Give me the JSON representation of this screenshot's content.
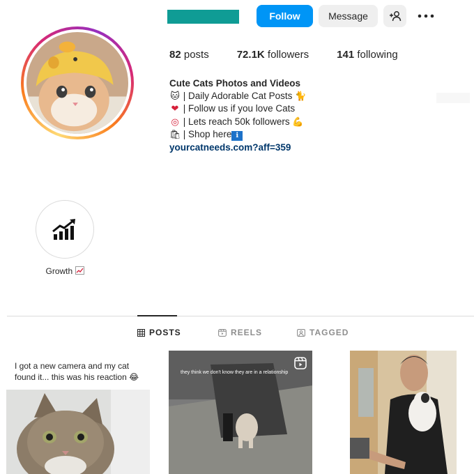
{
  "profile": {
    "follow_label": "Follow",
    "message_label": "Message",
    "stats": {
      "posts_count": "82",
      "posts_label": "posts",
      "followers_count": "72.1K",
      "followers_label": "followers",
      "following_count": "141",
      "following_label": "following"
    },
    "bio": {
      "name": "Cute Cats Photos and Videos",
      "line1": "| Daily Adorable Cat Posts",
      "line2": "| Follow us if you love Cats",
      "line3": "| Lets reach 50k followers",
      "line4": "| Shop here",
      "link": "yourcatneeds.com?aff=359"
    },
    "username_redaction_color": "#0f9c95",
    "accent_color": "#0095f6"
  },
  "highlights": [
    {
      "label": "Growth",
      "icon": "chart-increasing-icon"
    }
  ],
  "tabs": [
    {
      "label": "POSTS",
      "icon": "grid-icon",
      "active": true
    },
    {
      "label": "REELS",
      "icon": "reels-icon",
      "active": false
    },
    {
      "label": "TAGGED",
      "icon": "tagged-icon",
      "active": false
    }
  ],
  "posts": [
    {
      "caption": "I got a new camera and my cat found it... this was his reaction 😂"
    },
    {
      "caption": "they think we don't know they are in a relationship",
      "type": "reel"
    },
    {
      "caption": ""
    }
  ]
}
